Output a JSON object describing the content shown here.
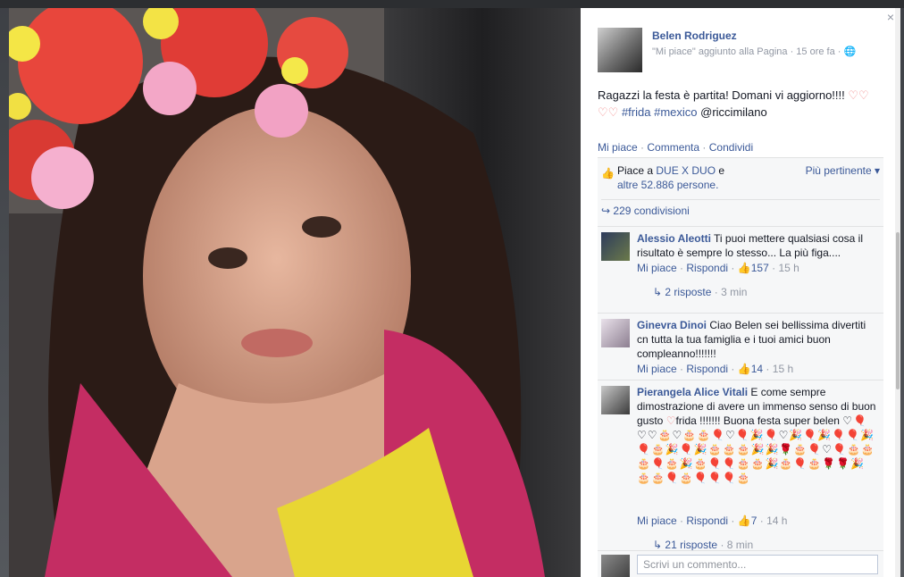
{
  "post": {
    "author": "Belen Rodriguez",
    "meta": "\"Mi piace\" aggiunto alla Pagina · 15 ore fa · ",
    "globe_icon": "globe-icon",
    "text_before": "Ragazzi la festa è partita! Domani vi aggiorno!!!! ",
    "hearts_a": "♡♡",
    "hearts_b": "♡♡",
    "tag_frida": "#frida",
    "tag_mexico": "#mexico",
    "mention": "@riccimilano"
  },
  "actions": {
    "like": "Mi piace",
    "comment": "Commenta",
    "share": "Condividi"
  },
  "likes": {
    "prefix": "Piace a ",
    "page": "DUE X DUO",
    "suffix": " e",
    "others": "altre 52.886 persone.",
    "sort": "Più pertinente ▾"
  },
  "shares": "229 condivisioni",
  "comments": [
    {
      "name": "Alessio Aleotti",
      "text": "Ti puoi mettere qualsiasi cosa il risultato è sempre lo stesso... La più figa....",
      "like": "Mi piace",
      "reply": "Rispondi",
      "count": "157",
      "time": "15 h",
      "replies": "2 risposte",
      "replies_time": "3 min"
    },
    {
      "name": "Ginevra Dinoi",
      "text": "Ciao Belen sei bellissima divertiti cn tutta la tua famiglia e i tuoi amici buon compleanno!!!!!!!",
      "like": "Mi piace",
      "reply": "Rispondi",
      "count": "14",
      "time": "15 h"
    },
    {
      "name": "Pierangela Alice Vitali",
      "text": "E come sempre dimostrazione di avere un immenso senso di buon gusto ",
      "text2": "frida !!!!!!! Buona festa super belen ",
      "emojis": "♡🎈♡♡🎂♡🎂🎂🎈♡🎈🎉🎈♡🎉🎈🎉🎈🎈🎉🎈🎂🎉🎈🎉🎂🎂🎂🎉🎉🌹🎂🎈♡🎈🎂🎂🎂🎈🎂🎉🎂🎈🎈🎂🎂🎉🎂🎈🎂🌹🌹🎉🎂🎂🎈🎂🎈🎈🎈🎂",
      "like": "Mi piace",
      "reply": "Rispondi",
      "count": "7",
      "time": "14 h",
      "replies": "21 risposte",
      "replies_time": "8 min"
    }
  ],
  "composer": {
    "placeholder": "Scrivi un commento..."
  },
  "icons": {
    "close": "×",
    "like": "👍",
    "share_arrow": "↪",
    "reply_arrow": "↳"
  }
}
